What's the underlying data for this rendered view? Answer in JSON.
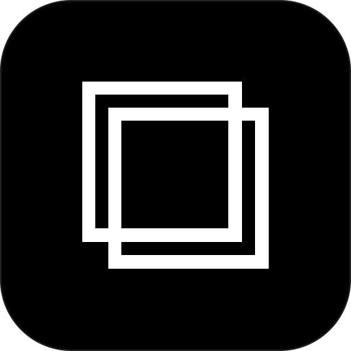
{
  "icon": {
    "name": "overlapping-squares-icon",
    "background_color": "#000000",
    "stroke_color": "#ffffff"
  }
}
